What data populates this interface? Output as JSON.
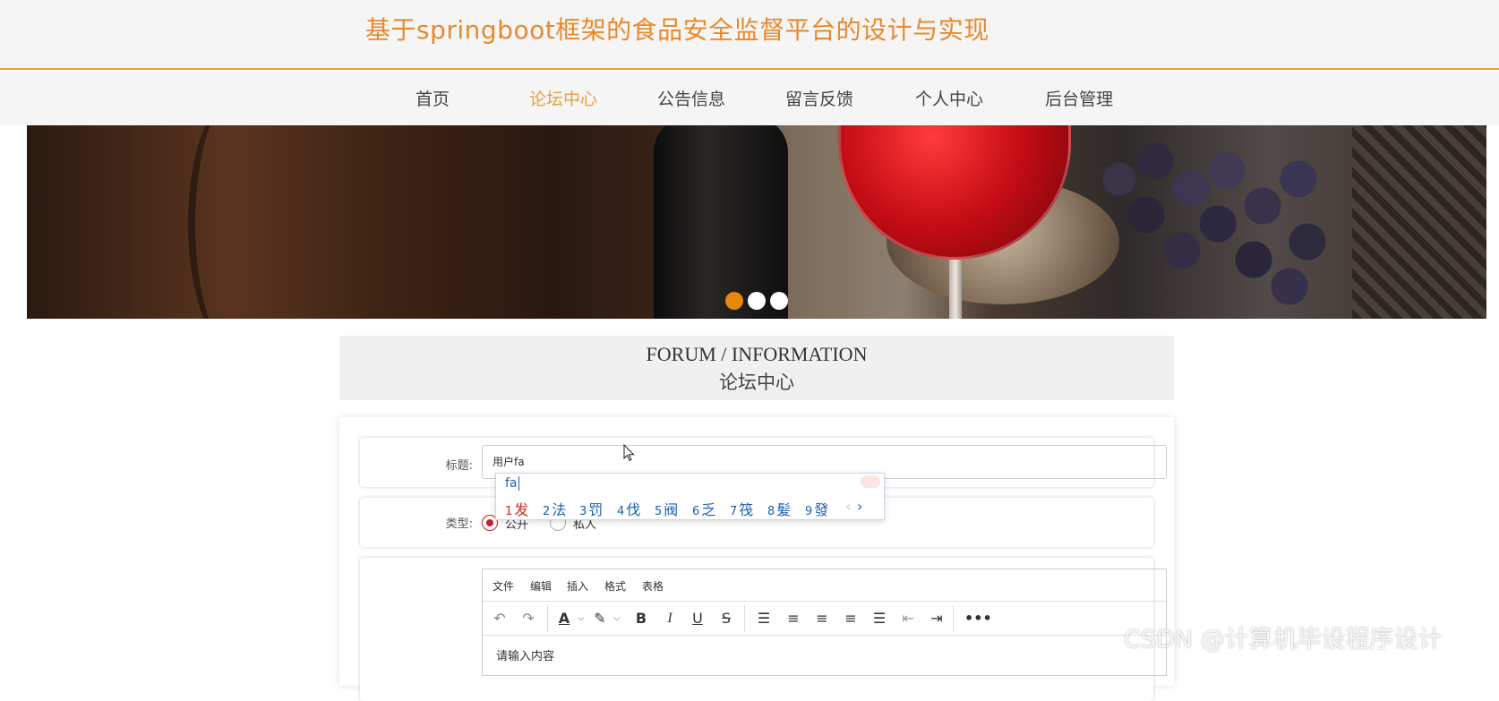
{
  "header": {
    "title": "基于springboot框架的食品安全监督平台的设计与实现"
  },
  "nav": {
    "items": [
      {
        "label": "首页"
      },
      {
        "label": "论坛中心",
        "active": true
      },
      {
        "label": "公告信息"
      },
      {
        "label": "留言反馈"
      },
      {
        "label": "个人中心"
      },
      {
        "label": "后台管理"
      }
    ]
  },
  "carousel": {
    "slides": 3,
    "active_index": 0,
    "accent_color": "#e8870f"
  },
  "section": {
    "title_en": "FORUM / INFORMATION",
    "title_cn": "论坛中心"
  },
  "form": {
    "title_label": "标题:",
    "title_value": "用户fa",
    "type_label": "类型:",
    "type_options": [
      {
        "label": "公开",
        "checked": true
      },
      {
        "label": "私人",
        "checked": false
      }
    ],
    "editor": {
      "menus": [
        "文件",
        "编辑",
        "插入",
        "格式",
        "表格"
      ],
      "toolbar_icons": [
        "undo-icon",
        "redo-icon",
        "font-color-icon",
        "highlight-icon",
        "bold-icon",
        "italic-icon",
        "underline-icon",
        "strikethrough-icon",
        "line-height-icon",
        "align-left-icon",
        "align-center-icon",
        "align-right-icon",
        "align-justify-icon",
        "outdent-icon",
        "indent-icon",
        "more-icon"
      ],
      "placeholder": "请输入内容"
    }
  },
  "ime": {
    "composition": "fa",
    "candidates": [
      {
        "num": "1",
        "text": "发"
      },
      {
        "num": "2",
        "text": "法"
      },
      {
        "num": "3",
        "text": "罚"
      },
      {
        "num": "4",
        "text": "伐"
      },
      {
        "num": "5",
        "text": "阀"
      },
      {
        "num": "6",
        "text": "乏"
      },
      {
        "num": "7",
        "text": "筏"
      },
      {
        "num": "8",
        "text": "髪"
      },
      {
        "num": "9",
        "text": "發"
      }
    ],
    "prev": "‹",
    "next": "›"
  },
  "watermark": "CSDN @计算机毕设程序设计"
}
